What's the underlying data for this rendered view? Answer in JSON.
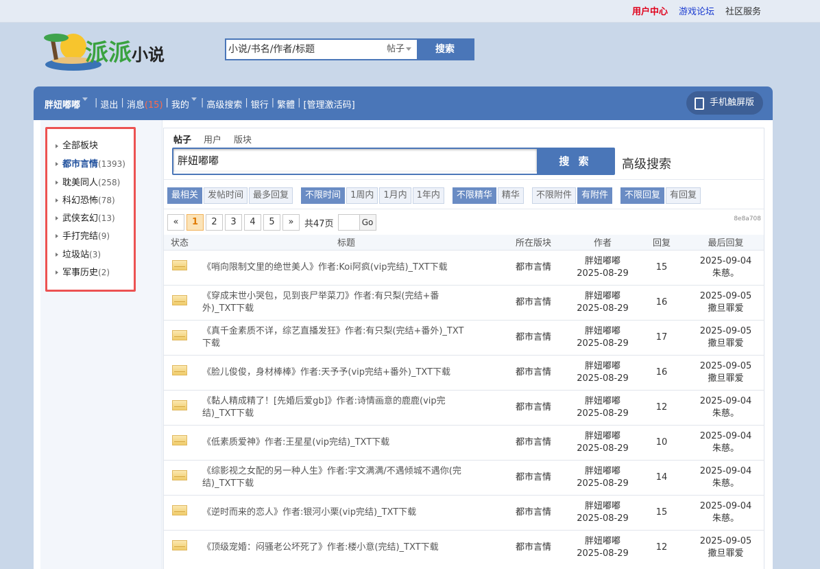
{
  "top_links": {
    "user_center": "用户中心",
    "game_forum": "游戏论坛",
    "community": "社区服务"
  },
  "logo": {
    "text": "派派",
    "text2": "小说"
  },
  "header_search": {
    "placeholder": "小说/书名/作者/标题",
    "type": "帖子",
    "button": "搜索"
  },
  "navbar": {
    "username": "胖妞嘟嘟",
    "logout": "退出",
    "messages": "消息",
    "message_count": "(15)",
    "mine": "我的",
    "advanced_search": "高级搜索",
    "bank": "银行",
    "traditional": "繁體",
    "admin_code": "[管理激活码]",
    "mobile": "手机触屏版"
  },
  "sidebar": {
    "items": [
      {
        "name": "全部板块",
        "count": ""
      },
      {
        "name": "都市言情",
        "count": "(1393)"
      },
      {
        "name": "耽美同人",
        "count": "(258)"
      },
      {
        "name": "科幻恐怖",
        "count": "(78)"
      },
      {
        "name": "武侠玄幻",
        "count": "(13)"
      },
      {
        "name": "手打完结",
        "count": "(9)"
      },
      {
        "name": "垃圾站",
        "count": "(3)"
      },
      {
        "name": "军事历史",
        "count": "(2)"
      }
    ]
  },
  "tabs": [
    "帖子",
    "用户",
    "版块"
  ],
  "search": {
    "value": "胖妞嘟嘟",
    "button": "搜 索",
    "advanced": "高级搜索"
  },
  "filters": {
    "sort": [
      "最相关",
      "发帖时间",
      "最多回复"
    ],
    "time": [
      "不限时间",
      "1周内",
      "1月内",
      "1年内"
    ],
    "digest": [
      "不限精华",
      "精华"
    ],
    "attach": [
      "不限附件",
      "有附件"
    ],
    "reply": [
      "不限回复",
      "有回复"
    ]
  },
  "hash": "8e8a708",
  "pager": {
    "prev": "«",
    "pages": [
      "1",
      "2",
      "3",
      "4",
      "5"
    ],
    "next": "»",
    "total": "共47页",
    "go": "Go"
  },
  "table": {
    "headers": [
      "状态",
      "标题",
      "所在版块",
      "作者",
      "回复",
      "最后回复"
    ],
    "rows": [
      {
        "title": "《哨向限制文里的绝世美人》作者:Koi阿疯(vip完结)_TXT下载",
        "board": "都市言情",
        "author": "胖妞嘟嘟",
        "date": "2025-08-29",
        "replies": "15",
        "last_date": "2025-09-04",
        "last_user": "朱慈。"
      },
      {
        "title": "《穿成末世小哭包，见到丧尸举菜刀》作者:有只梨(完结+番外)_TXT下载",
        "board": "都市言情",
        "author": "胖妞嘟嘟",
        "date": "2025-08-29",
        "replies": "16",
        "last_date": "2025-09-05",
        "last_user": "撒旦罪爱"
      },
      {
        "title": "《真千金素质不详，综艺直播发狂》作者:有只梨(完结+番外)_TXT下载",
        "board": "都市言情",
        "author": "胖妞嘟嘟",
        "date": "2025-08-29",
        "replies": "17",
        "last_date": "2025-09-05",
        "last_user": "撒旦罪爱"
      },
      {
        "title": "《脸儿俊俊，身材棒棒》作者:天予予(vip完结+番外)_TXT下载",
        "board": "都市言情",
        "author": "胖妞嘟嘟",
        "date": "2025-08-29",
        "replies": "16",
        "last_date": "2025-09-05",
        "last_user": "撒旦罪爱"
      },
      {
        "title": "《黏人精成精了！[先婚后爱gb]》作者:诗情画意的鹿鹿(vip完结)_TXT下载",
        "board": "都市言情",
        "author": "胖妞嘟嘟",
        "date": "2025-08-29",
        "replies": "12",
        "last_date": "2025-09-04",
        "last_user": "朱慈。"
      },
      {
        "title": "《低素质爱神》作者:王星星(vip完结)_TXT下载",
        "board": "都市言情",
        "author": "胖妞嘟嘟",
        "date": "2025-08-29",
        "replies": "10",
        "last_date": "2025-09-04",
        "last_user": "朱慈。"
      },
      {
        "title": "《综影视之女配的另一种人生》作者:宇文满满/不遇倾城不遇你(完结)_TXT下载",
        "board": "都市言情",
        "author": "胖妞嘟嘟",
        "date": "2025-08-29",
        "replies": "14",
        "last_date": "2025-09-04",
        "last_user": "朱慈。"
      },
      {
        "title": "《逆时而来的恋人》作者:银河小栗(vip完结)_TXT下载",
        "board": "都市言情",
        "author": "胖妞嘟嘟",
        "date": "2025-08-29",
        "replies": "15",
        "last_date": "2025-09-04",
        "last_user": "朱慈。"
      },
      {
        "title": "《顶级宠婚：闷骚老公坏死了》作者:楼小意(完结)_TXT下载",
        "board": "都市言情",
        "author": "胖妞嘟嘟",
        "date": "2025-08-29",
        "replies": "12",
        "last_date": "2025-09-05",
        "last_user": "撒旦罪爱"
      }
    ]
  }
}
